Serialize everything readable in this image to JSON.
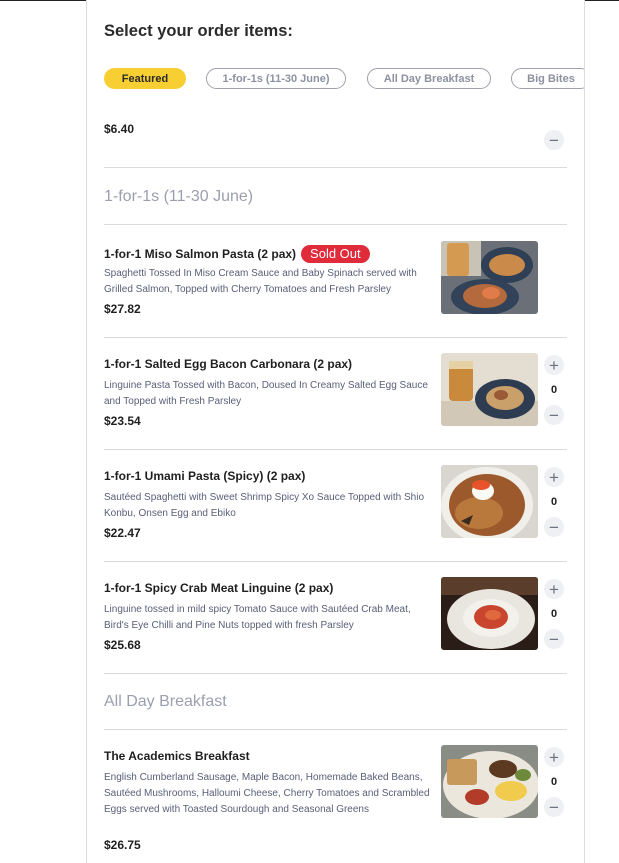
{
  "heading": "Select your order items:",
  "tabs": [
    {
      "label": "Featured",
      "active": true
    },
    {
      "label": "1-for-1s (11-30 June)",
      "active": false
    },
    {
      "label": "All Day Breakfast",
      "active": false
    },
    {
      "label": "Big Bites",
      "active": false
    }
  ],
  "top_item": {
    "price": "$6.40"
  },
  "sections": {
    "one_for_one": "1-for-1s (11-30 June)",
    "all_day_breakfast": "All Day Breakfast"
  },
  "items": [
    {
      "name": "1-for-1 Miso Salmon Pasta (2 pax)",
      "badge": "Sold Out",
      "desc": "Spaghetti Tossed In Miso Cream Sauce and Baby Spinach served with Grilled Salmon, Topped with Cherry Tomatoes and Fresh Parsley",
      "price": "$27.82"
    },
    {
      "name": "1-for-1 Salted Egg Bacon Carbonara (2 pax)",
      "desc": "Linguine Pasta Tossed with Bacon, Doused In Creamy Salted Egg Sauce and Topped with Fresh Parsley",
      "price": "$23.54",
      "qty": "0"
    },
    {
      "name": "1-for-1 Umami Pasta (Spicy) (2 pax)",
      "desc": "Sautéed Spaghetti with Sweet Shrimp Spicy Xo Sauce Topped with Shio Konbu, Onsen Egg and Ebiko",
      "price": "$22.47",
      "qty": "0"
    },
    {
      "name": "1-for-1 Spicy Crab Meat Linguine (2 pax)",
      "desc": "Linguine tossed in mild spicy Tomato Sauce with Sautéed Crab Meat, Bird's Eye Chilli and Pine Nuts topped with fresh Parsley",
      "price": "$25.68",
      "qty": "0"
    },
    {
      "name": "The Academics Breakfast",
      "desc": "English Cumberland Sausage, Maple Bacon, Homemade Baked Beans, Sautéed Mushrooms, Halloumi Cheese, Cherry Tomatoes and Scrambled Eggs served with Toasted Sourdough and Seasonal Greens",
      "price": "$26.75",
      "qty": "0"
    }
  ],
  "icons": {
    "plus": "plus-icon",
    "minus": "minus-icon"
  },
  "colors": {
    "accent": "#f8cf33",
    "sold_out": "#df2b3a",
    "section_title": "#9b9fae",
    "desc_text": "#5a5e78"
  }
}
